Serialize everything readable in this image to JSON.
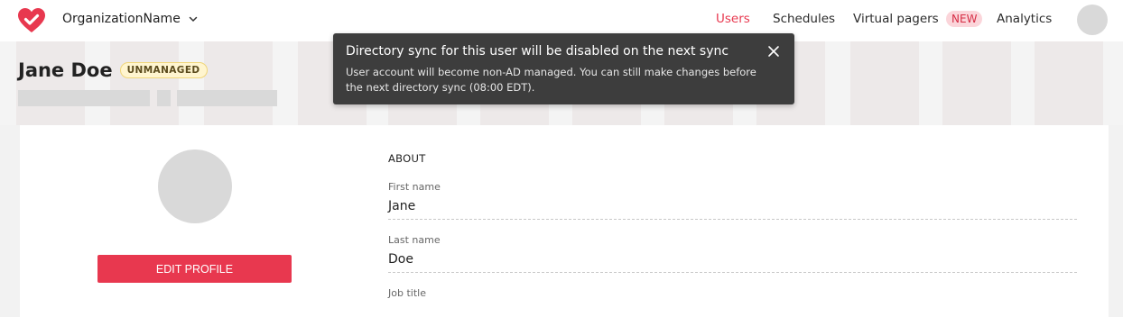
{
  "topbar": {
    "org_name": "OrganizationName",
    "nav": [
      {
        "label": "Users",
        "active": true
      },
      {
        "label": "Schedules"
      },
      {
        "label": "Virtual pagers",
        "badge": "NEW"
      },
      {
        "label": "Analytics"
      }
    ]
  },
  "user": {
    "name": "Jane Doe",
    "status_badge": "UNMANAGED"
  },
  "profile": {
    "edit_label": "EDIT PROFILE",
    "about_title": "ABOUT",
    "fields": [
      {
        "label": "First name",
        "value": "Jane"
      },
      {
        "label": "Last name",
        "value": "Doe"
      },
      {
        "label": "Job title",
        "value": ""
      }
    ]
  },
  "toast": {
    "title": "Directory sync for this user will be disabled on the next sync",
    "body": "User account will become non-AD managed. You can still make changes before the next directory sync (08:00 EDT)."
  },
  "colors": {
    "accent": "#e8384f",
    "toast_bg": "#3d3d3d",
    "badge_bg": "#fff5cf"
  },
  "icons": {
    "logo": "heart-check-icon",
    "org_dropdown": "chevron-down-icon",
    "toast_close": "close-icon"
  }
}
